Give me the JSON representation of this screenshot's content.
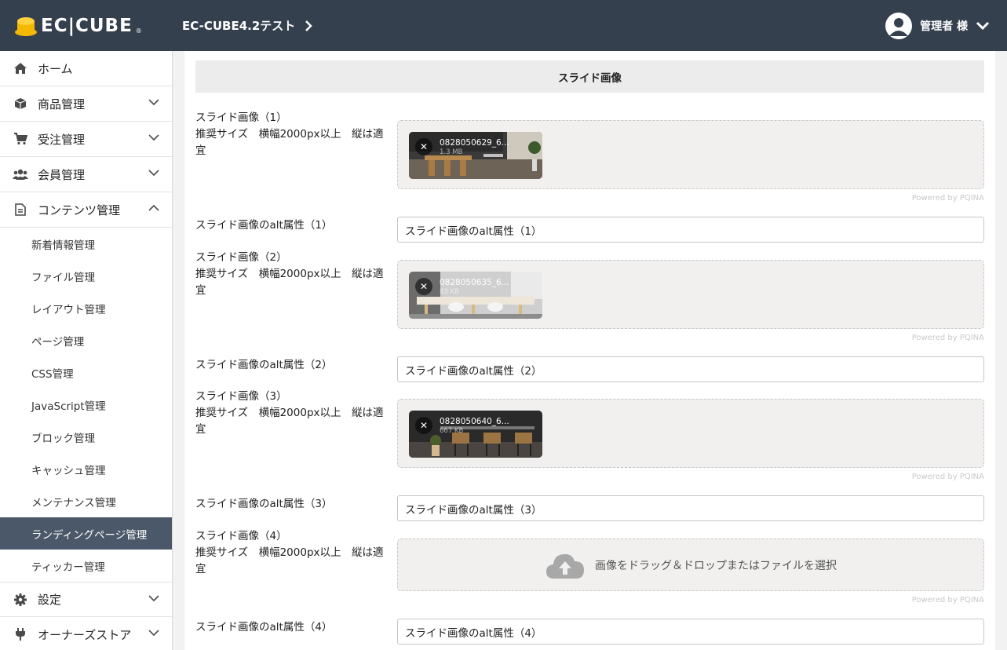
{
  "header": {
    "logo_text": "EC|CUBE",
    "logo_reg": "®",
    "shop_name": "EC-CUBE4.2テスト",
    "user_name": "管理者 様"
  },
  "sidebar": {
    "items": [
      {
        "label": "ホーム",
        "icon": "home-icon"
      },
      {
        "label": "商品管理",
        "icon": "cube-icon"
      },
      {
        "label": "受注管理",
        "icon": "cart-icon"
      },
      {
        "label": "会員管理",
        "icon": "users-icon"
      },
      {
        "label": "コンテンツ管理",
        "icon": "file-icon"
      }
    ],
    "sub_items": [
      "新着情報管理",
      "ファイル管理",
      "レイアウト管理",
      "ページ管理",
      "CSS管理",
      "JavaScript管理",
      "ブロック管理",
      "キャッシュ管理",
      "メンテナンス管理",
      "ランディングページ管理",
      "ティッカー管理"
    ],
    "bottom_items": [
      {
        "label": "設定",
        "icon": "gear-icon"
      },
      {
        "label": "オーナーズストア",
        "icon": "plug-icon"
      }
    ]
  },
  "main": {
    "section_title": "スライド画像",
    "powered_by": "Powered by PQINA",
    "slides": [
      {
        "label_line1": "スライド画像（1）",
        "label_line2": "推奨サイズ　横幅2000px以上　縦は適",
        "label_line3": "宜",
        "file_name": "0828050629_6...",
        "file_size": "1.3 MB",
        "alt_label": "スライド画像のalt属性（1）",
        "alt_value": "スライド画像のalt属性（1）"
      },
      {
        "label_line1": "スライド画像（2）",
        "label_line2": "推奨サイズ　横幅2000px以上　縦は適",
        "label_line3": "宜",
        "file_name": "0828050635_6...",
        "file_size": "83 KB",
        "alt_label": "スライド画像のalt属性（2）",
        "alt_value": "スライド画像のalt属性（2）"
      },
      {
        "label_line1": "スライド画像（3）",
        "label_line2": "推奨サイズ　横幅2000px以上　縦は適",
        "label_line3": "宜",
        "file_name": "0828050640_6...",
        "file_size": "667 KB",
        "alt_label": "スライド画像のalt属性（3）",
        "alt_value": "スライド画像のalt属性（3）"
      },
      {
        "label_line1": "スライド画像（4）",
        "label_line2": "推奨サイズ　横幅2000px以上　縦は適",
        "label_line3": "宜",
        "drop_text": "画像をドラッグ＆ドロップまたはファイルを選択",
        "alt_label": "スライド画像のalt属性（4）",
        "alt_value": "スライド画像のalt属性（4）"
      }
    ]
  },
  "colors": {
    "header_bg": "#35404f",
    "active_bg": "#4b5869",
    "logo_yellow": "#f5b800"
  }
}
